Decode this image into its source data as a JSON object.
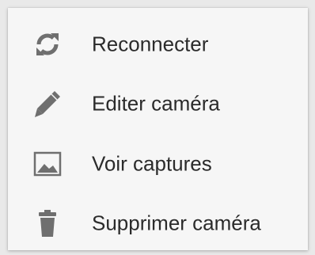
{
  "menu": {
    "items": [
      {
        "label": "Reconnecter",
        "icon": "refresh-icon"
      },
      {
        "label": "Editer caméra",
        "icon": "pencil-icon"
      },
      {
        "label": "Voir captures",
        "icon": "image-icon"
      },
      {
        "label": "Supprimer caméra",
        "icon": "trash-icon"
      }
    ]
  },
  "colors": {
    "icon": "#6f6f6f",
    "text": "#2b2b2b",
    "background": "#f6f6f6"
  }
}
